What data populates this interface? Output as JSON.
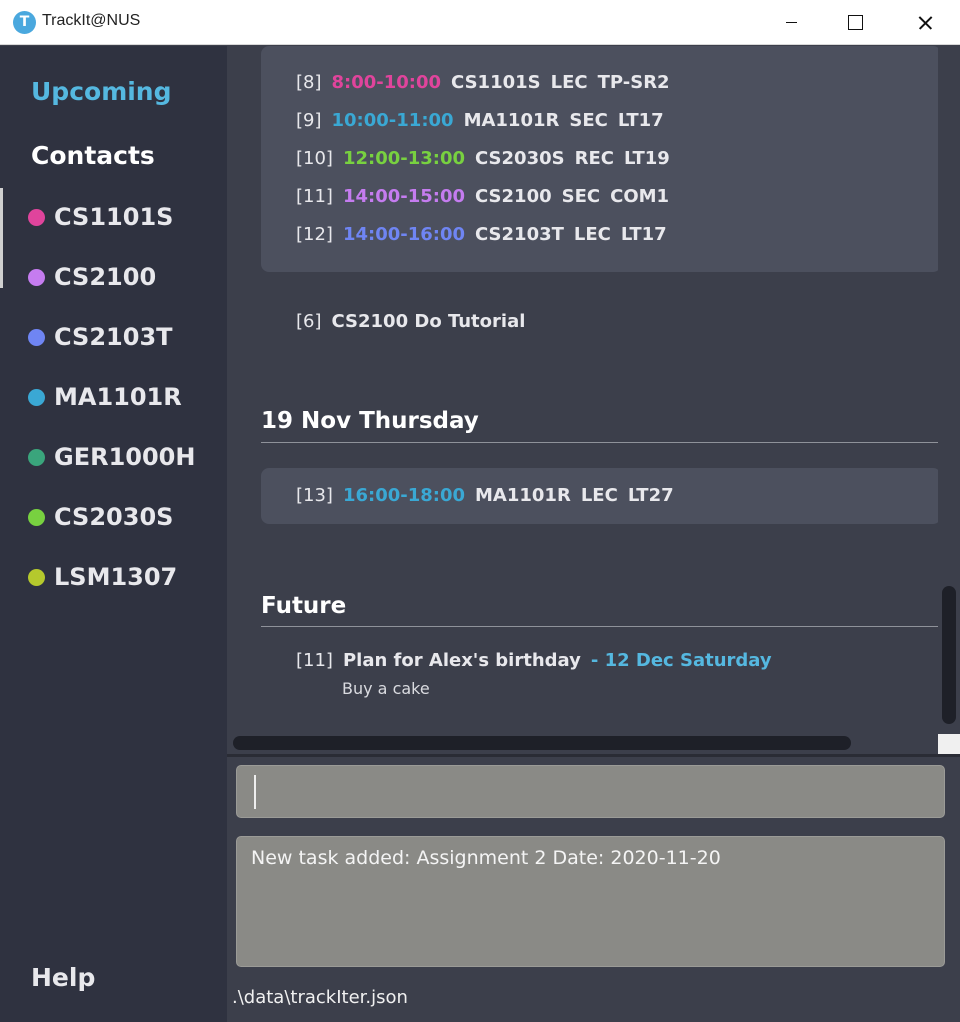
{
  "window": {
    "title": "TrackIt@NUS",
    "icon": "T"
  },
  "sidebar": {
    "upcoming": "Upcoming",
    "contacts": "Contacts",
    "modules": [
      {
        "name": "CS1101S",
        "color": "#e0449c"
      },
      {
        "name": "CS2100",
        "color": "#c57cf0"
      },
      {
        "name": "CS2103T",
        "color": "#6f85f3"
      },
      {
        "name": "MA1101R",
        "color": "#3aa8d4"
      },
      {
        "name": "GER1000H",
        "color": "#3aa57c"
      },
      {
        "name": "CS2030S",
        "color": "#78d140"
      },
      {
        "name": "LSM1307",
        "color": "#b5c92d"
      }
    ],
    "help": "Help"
  },
  "main": {
    "lessons_block1": [
      {
        "idx": "[8]",
        "time": "8:00-10:00",
        "color": "#e0449c",
        "code": "CS1101S",
        "kind": "LEC",
        "venue": "TP-SR2"
      },
      {
        "idx": "[9]",
        "time": "10:00-11:00",
        "color": "#3aa8d4",
        "code": "MA1101R",
        "kind": "SEC",
        "venue": "LT17"
      },
      {
        "idx": "[10]",
        "time": "12:00-13:00",
        "color": "#78d140",
        "code": "CS2030S",
        "kind": "REC",
        "venue": "LT19"
      },
      {
        "idx": "[11]",
        "time": "14:00-15:00",
        "color": "#c57cf0",
        "code": "CS2100",
        "kind": "SEC",
        "venue": "COM1"
      },
      {
        "idx": "[12]",
        "time": "14:00-16:00",
        "color": "#6f85f3",
        "code": "CS2103T",
        "kind": "LEC",
        "venue": "LT17"
      }
    ],
    "task1": {
      "idx": "[6]",
      "title": "CS2100 Do Tutorial"
    },
    "day2": {
      "header": "19 Nov Thursday",
      "lesson": {
        "idx": "[13]",
        "time": "16:00-18:00",
        "color": "#3aa8d4",
        "code": "MA1101R",
        "kind": "LEC",
        "venue": "LT27"
      }
    },
    "future": {
      "header": "Future",
      "task": {
        "idx": "[11]",
        "title": "Plan for Alex's birthday",
        "date": "- 12 Dec Saturday",
        "desc": "Buy a cake"
      }
    }
  },
  "command": {
    "value": ""
  },
  "result": {
    "text": "New task added: Assignment 2 Date: 2020-11-20"
  },
  "status": {
    "path": ".\\data\\trackIter.json"
  }
}
